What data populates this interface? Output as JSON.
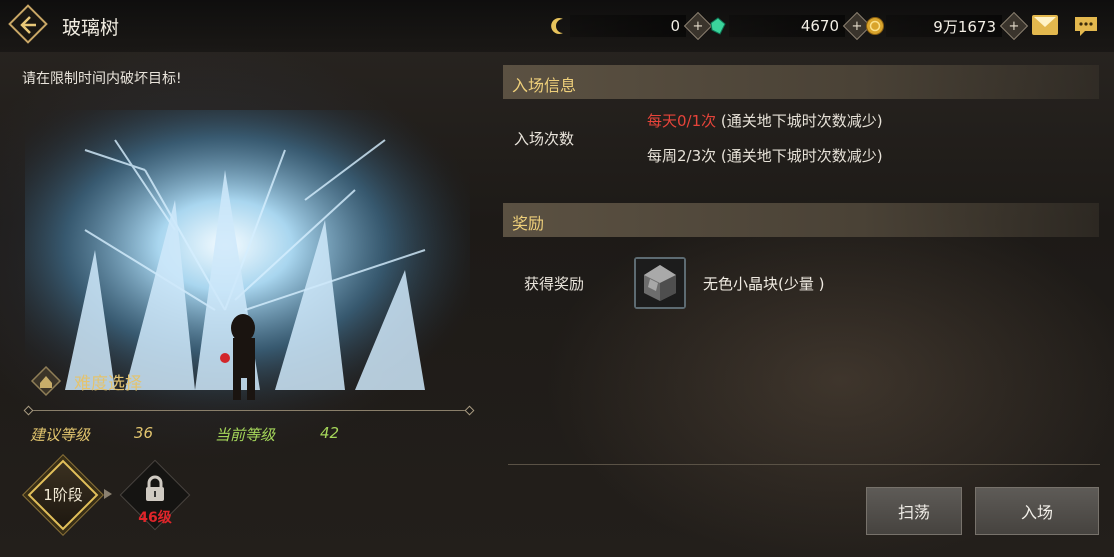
{
  "header": {
    "title": "玻璃树",
    "currencies": [
      {
        "icon": "moon-coin-icon",
        "value": "0"
      },
      {
        "icon": "green-gem-icon",
        "value": "4670"
      },
      {
        "icon": "gold-coin-icon",
        "value": "9万1673"
      }
    ],
    "plus_label": "+"
  },
  "left": {
    "hint": "请在限制时间内破坏目标!",
    "difficulty_label": "难度选择",
    "recommended_level_label": "建议等级",
    "recommended_level": "36",
    "current_level_label": "当前等级",
    "current_level": "42",
    "stage1_label": "1阶段",
    "locked_level": "46级"
  },
  "entry_info": {
    "heading": "入场信息",
    "count_label": "入场次数",
    "daily": "每天0/1次",
    "daily_note": " (通关地下城时次数减少)",
    "weekly": "每周2/3次",
    "weekly_note": " (通关地下城时次数减少)"
  },
  "reward": {
    "heading": "奖励",
    "label": "获得奖励",
    "item_name": "无色小晶块(少量 )"
  },
  "buttons": {
    "sweep": "扫荡",
    "enter": "入场"
  },
  "colors": {
    "accent_gold": "#eecf7a",
    "warning_red": "#e6443a"
  }
}
